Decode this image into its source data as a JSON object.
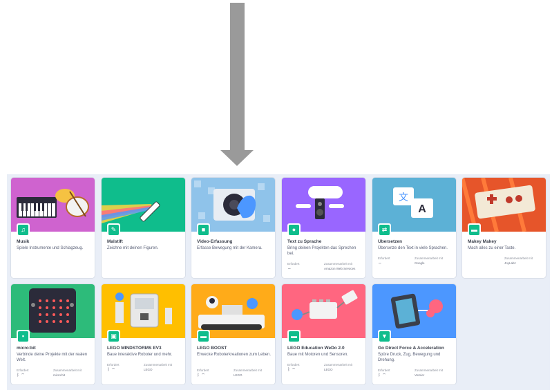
{
  "cards": [
    {
      "title": "Musik",
      "description": "Spiele Instrumente und Schlagzeug.",
      "badge_icon": "music-note-icon",
      "badge_color": "#0fbd8c"
    },
    {
      "title": "Malstift",
      "description": "Zeichne mit deinen Figuren.",
      "badge_icon": "pen-icon",
      "badge_color": "#0fbd8c"
    },
    {
      "title": "Video-Erfassung",
      "description": "Erfasse Bewegung mit der Kamera.",
      "badge_icon": "video-icon",
      "badge_color": "#0fbd8c"
    },
    {
      "title": "Text zu Sprache",
      "description": "Bring deinen Projekten das Sprechen bei.",
      "badge_icon": "speech-icon",
      "badge_color": "#0fbd8c",
      "meta": {
        "req_label": "Erfordert",
        "collab_label": "Zusammenarbeit mit",
        "collab_value": "Amazon Web Services",
        "icons": "wifi"
      }
    },
    {
      "title": "Übersetzen",
      "description": "Übersetze den Text in viele Sprachen.",
      "badge_icon": "translate-icon",
      "badge_color": "#0fbd8c",
      "meta": {
        "req_label": "Erfordert",
        "collab_label": "Zusammenarbeit mit",
        "collab_value": "Google",
        "icons": "wifi"
      }
    },
    {
      "title": "Makey Makey",
      "description": "Mach alles zu einer Taste.",
      "badge_icon": "makey-icon",
      "badge_color": "#0fbd8c",
      "meta": {
        "req_label": "",
        "collab_label": "Zusammenarbeit mit",
        "collab_value": "JoyLabz",
        "icons": ""
      }
    },
    {
      "title": "micro:bit",
      "description": "Verbinde deine Projekte mit der realen Welt.",
      "badge_icon": "microbit-icon",
      "badge_color": "#0fbd8c",
      "meta": {
        "req_label": "Erfordert",
        "collab_label": "Zusammenarbeit mit",
        "collab_value": "micro:bit",
        "icons": "bt wifi"
      }
    },
    {
      "title": "LEGO MINDSTORMS EV3",
      "description": "Baue interaktive Roboter und mehr.",
      "badge_icon": "ev3-icon",
      "badge_color": "#0fbd8c",
      "meta": {
        "req_label": "Erfordert",
        "collab_label": "Zusammenarbeit mit",
        "collab_value": "LEGO",
        "icons": "bt wifi"
      }
    },
    {
      "title": "LEGO BOOST",
      "description": "Erwecke Roboterkreationen zum Leben.",
      "badge_icon": "boost-icon",
      "badge_color": "#0fbd8c",
      "meta": {
        "req_label": "Erfordert",
        "collab_label": "Zusammenarbeit mit",
        "collab_value": "LEGO",
        "icons": "bt wifi"
      }
    },
    {
      "title": "LEGO Education WeDo 2.0",
      "description": "Baue mit Motoren und Sensoren.",
      "badge_icon": "wedo-icon",
      "badge_color": "#0fbd8c",
      "meta": {
        "req_label": "Erfordert",
        "collab_label": "Zusammenarbeit mit",
        "collab_value": "LEGO",
        "icons": "bt wifi"
      }
    },
    {
      "title": "Go Direct Force & Acceleration",
      "description": "Spüre Druck, Zug, Bewegung und Drehung.",
      "badge_icon": "force-icon",
      "badge_color": "#0fbd8c",
      "meta": {
        "req_label": "Erfordert",
        "collab_label": "Zusammenarbeit mit",
        "collab_value": "Vernier",
        "icons": "bt wifi"
      }
    }
  ]
}
